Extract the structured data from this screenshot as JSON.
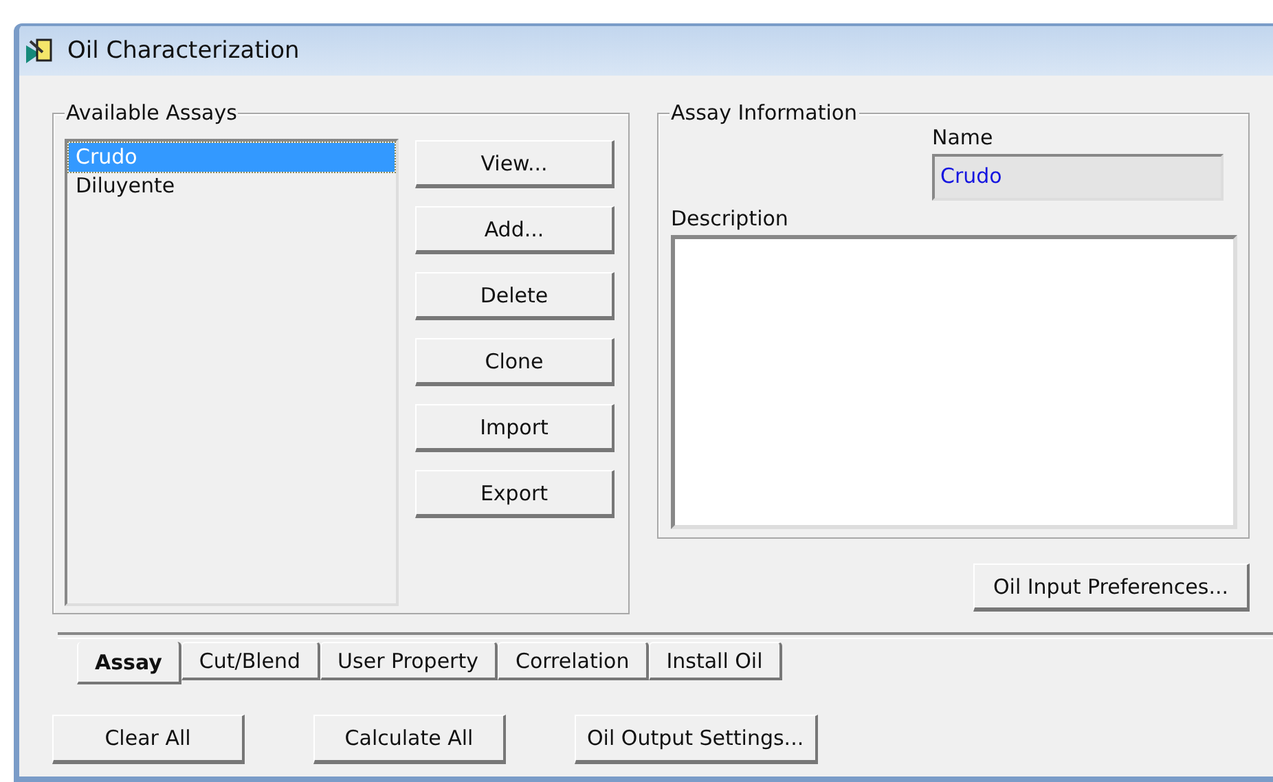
{
  "window": {
    "title": "Oil  Characterization"
  },
  "available_assays": {
    "title": "Available Assays",
    "items": [
      {
        "label": "Crudo",
        "selected": true
      },
      {
        "label": "Diluyente",
        "selected": false
      }
    ]
  },
  "assay_buttons": [
    "View...",
    "Add...",
    "Delete",
    "Clone",
    "Import",
    "Export"
  ],
  "assay_information": {
    "title": "Assay  Information",
    "name_label": "Name",
    "name_value": "Crudo",
    "description_label": "Description"
  },
  "oil_input_preferences_button": "Oil Input Preferences...",
  "tabs": [
    {
      "label": "Assay",
      "selected": true
    },
    {
      "label": "Cut/Blend",
      "selected": false
    },
    {
      "label": "User Property",
      "selected": false
    },
    {
      "label": "Correlation",
      "selected": false
    },
    {
      "label": "Install Oil",
      "selected": false
    }
  ],
  "bottom_buttons": [
    "Clear All",
    "Calculate All",
    "Oil Output Settings..."
  ]
}
